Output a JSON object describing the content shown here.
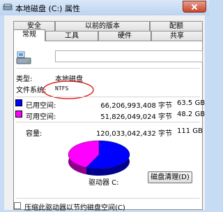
{
  "window": {
    "title": "本地磁盘 (C:) 属性",
    "blurred_title_hint": ""
  },
  "tabs_row1": [
    "安全",
    "以前的版本",
    "配额"
  ],
  "tabs_row2": [
    "常规",
    "工具",
    "硬件",
    "共享"
  ],
  "active_tab": "常规",
  "general": {
    "name_value": "",
    "type_label": "类型:",
    "type_value": "本地磁盘",
    "fs_label": "文件系统:",
    "fs_value": "NTFS",
    "used": {
      "label": "已用空间:",
      "bytes": "66,206,993,408 字节",
      "size": "63.5 GB",
      "color": "#0000ff"
    },
    "free": {
      "label": "可用空间:",
      "bytes": "51,826,049,024 字节",
      "size": "48.2 GB",
      "color": "#ff00ff"
    },
    "capacity": {
      "label": "容量:",
      "bytes": "120,033,042,432 字节",
      "size": "111 GB"
    },
    "drive_label": "驱动器 C:",
    "cleanup_button": "磁盘清理(D)",
    "compress_label": "压缩此驱动器以节约磁盘空间(C)"
  },
  "chart_data": {
    "type": "pie",
    "categories": [
      "已用空间",
      "可用空间"
    ],
    "values": [
      63.5,
      48.2
    ],
    "colors": [
      "#0000ff",
      "#ff00ff"
    ]
  },
  "colors": {
    "annotation": "#e02020",
    "titlebar": "#c6dcf4",
    "panel_bg": "#ffffff"
  }
}
